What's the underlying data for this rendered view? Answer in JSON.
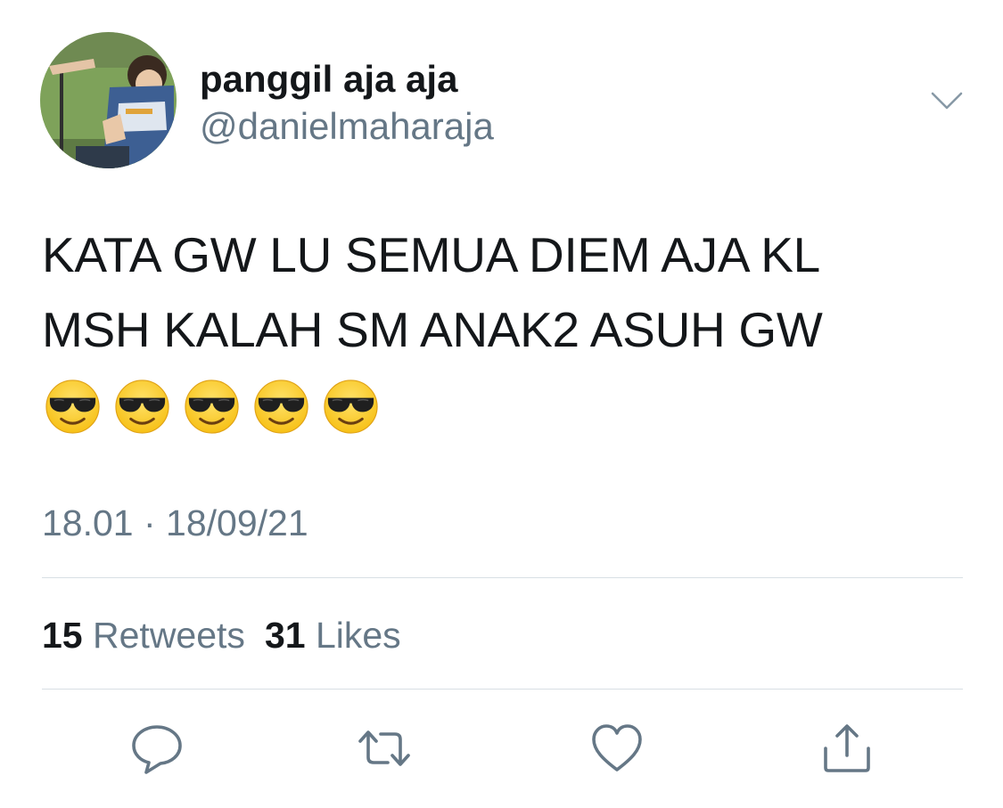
{
  "author": {
    "display_name": "panggil aja aja",
    "handle": "@danielmaharaja",
    "avatar_icon": "profile-photo"
  },
  "tweet": {
    "lines": [
      "KATA GW LU SEMUA DIEM AJA KL",
      "MSH KALAH SM ANAK2 ASUH GW"
    ],
    "emoji": [
      "😎",
      "😎",
      "😎",
      "😎",
      "😎"
    ],
    "emoji_name": "smiling-face-with-sunglasses",
    "timestamp": "18.01 · 18/09/21"
  },
  "stats": {
    "retweets_count": "15",
    "retweets_label": "Retweets",
    "likes_count": "31",
    "likes_label": "Likes"
  },
  "actions": [
    {
      "name": "reply",
      "icon": "reply-icon"
    },
    {
      "name": "retweet",
      "icon": "retweet-icon"
    },
    {
      "name": "like",
      "icon": "heart-icon"
    },
    {
      "name": "share",
      "icon": "share-icon"
    }
  ],
  "colors": {
    "text_primary": "#14171a",
    "text_secondary": "#657786",
    "icon": "#657786",
    "divider": "#d8dfe4",
    "emoji_face": "#f7c21a"
  }
}
